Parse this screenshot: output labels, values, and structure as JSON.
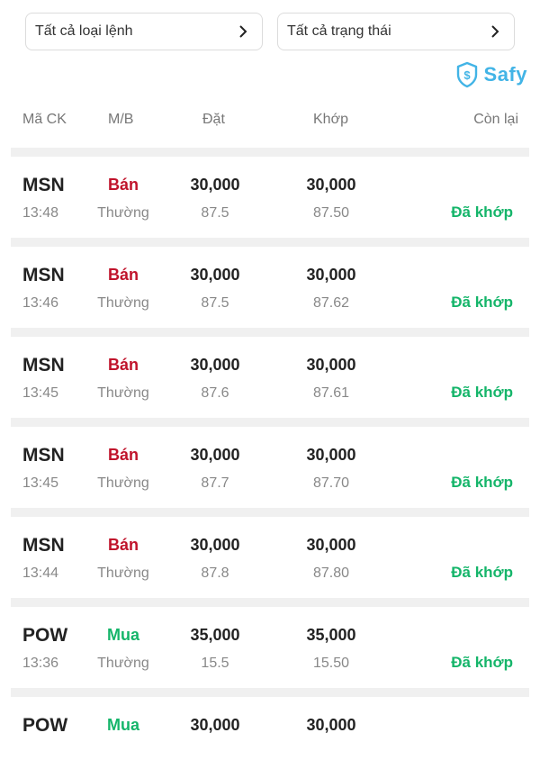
{
  "filters": {
    "order_type": "Tất cả loại lệnh",
    "status": "Tất cả trạng thái"
  },
  "brand": {
    "name": "Safy",
    "color": "#42b4e6"
  },
  "columns": {
    "symbol": "Mã CK",
    "side": "M/B",
    "order": "Đặt",
    "matched": "Khớp",
    "remaining": "Còn lại"
  },
  "colors": {
    "sell": "#c0132b",
    "buy": "#15b56a",
    "matched_status": "#15b56a"
  },
  "orders": [
    {
      "symbol": "MSN",
      "time": "13:48",
      "side": "Bán",
      "side_type": "sell",
      "order_type": "Thường",
      "order_qty": "30,000",
      "order_price": "87.5",
      "match_qty": "30,000",
      "match_price": "87.50",
      "status": "Đã khớp"
    },
    {
      "symbol": "MSN",
      "time": "13:46",
      "side": "Bán",
      "side_type": "sell",
      "order_type": "Thường",
      "order_qty": "30,000",
      "order_price": "87.5",
      "match_qty": "30,000",
      "match_price": "87.62",
      "status": "Đã khớp"
    },
    {
      "symbol": "MSN",
      "time": "13:45",
      "side": "Bán",
      "side_type": "sell",
      "order_type": "Thường",
      "order_qty": "30,000",
      "order_price": "87.6",
      "match_qty": "30,000",
      "match_price": "87.61",
      "status": "Đã khớp"
    },
    {
      "symbol": "MSN",
      "time": "13:45",
      "side": "Bán",
      "side_type": "sell",
      "order_type": "Thường",
      "order_qty": "30,000",
      "order_price": "87.7",
      "match_qty": "30,000",
      "match_price": "87.70",
      "status": "Đã khớp"
    },
    {
      "symbol": "MSN",
      "time": "13:44",
      "side": "Bán",
      "side_type": "sell",
      "order_type": "Thường",
      "order_qty": "30,000",
      "order_price": "87.8",
      "match_qty": "30,000",
      "match_price": "87.80",
      "status": "Đã khớp"
    },
    {
      "symbol": "POW",
      "time": "13:36",
      "side": "Mua",
      "side_type": "buy",
      "order_type": "Thường",
      "order_qty": "35,000",
      "order_price": "15.5",
      "match_qty": "35,000",
      "match_price": "15.50",
      "status": "Đã khớp"
    },
    {
      "symbol": "POW",
      "time": "",
      "side": "Mua",
      "side_type": "buy",
      "order_type": "",
      "order_qty": "30,000",
      "order_price": "",
      "match_qty": "30,000",
      "match_price": "",
      "status": ""
    }
  ]
}
